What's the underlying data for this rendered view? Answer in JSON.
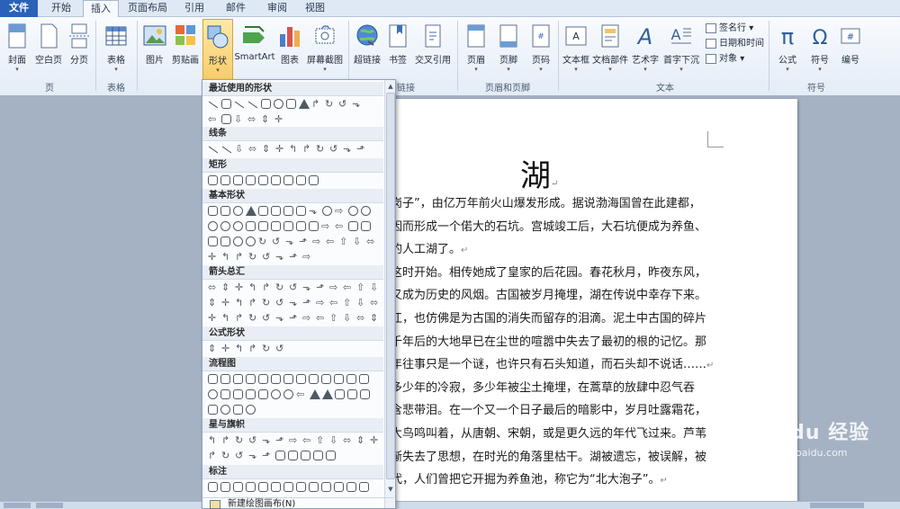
{
  "menubar": {
    "tabs": [
      {
        "label": "文件"
      },
      {
        "label": "开始"
      },
      {
        "label": "插入"
      },
      {
        "label": "页面布局"
      },
      {
        "label": "引用"
      },
      {
        "label": "邮件"
      },
      {
        "label": "审阅"
      },
      {
        "label": "视图"
      }
    ]
  },
  "ribbon": {
    "pages": {
      "cover": "封面",
      "blank": "空白页",
      "break": "分页",
      "group": "页"
    },
    "tables": {
      "table": "表格",
      "group": "表格"
    },
    "illustrations": {
      "picture": "图片",
      "clipart": "剪贴画",
      "shapes": "形状",
      "smartart": "SmartArt",
      "chart": "图表",
      "screenshot": "屏幕截图"
    },
    "links": {
      "hyperlink": "超链接",
      "bookmark": "书签",
      "crossref": "交叉引用",
      "group": "链接"
    },
    "headerfooter": {
      "header": "页眉",
      "footer": "页脚",
      "pagenum": "页码",
      "group": "页眉和页脚"
    },
    "text": {
      "textbox": "文本框",
      "parts": "文档部件",
      "wordart": "艺术字",
      "dropcap": "首字下沉",
      "signature": "签名行",
      "datetime": "日期和时间",
      "object": "对象",
      "group": "文本"
    },
    "symbols": {
      "equation": "公式",
      "symbol": "符号",
      "number": "编号",
      "group": "符号"
    }
  },
  "dropdown_arrow": "▾",
  "shapes_menu": {
    "sections": [
      {
        "title": "最近使用的形状"
      },
      {
        "title": "线条"
      },
      {
        "title": "矩形"
      },
      {
        "title": "基本形状"
      },
      {
        "title": "箭头总汇"
      },
      {
        "title": "公式形状"
      },
      {
        "title": "流程图"
      },
      {
        "title": "星与旗帜"
      },
      {
        "title": "标注"
      }
    ],
    "new_canvas": "新建绘图画布(N)"
  },
  "document": {
    "title": "湖",
    "lines": [
      "岗子”，由亿万年前火山爆发形成。据说渤海国曾在此建都，",
      "因而形成一个偌大的石坑。宫城竣工后，大石坑便成为养鱼、",
      "的人工湖了。",
      "这时开始。相传她成了皇家的后花园。春花秋月，昨夜东风，",
      "又成为历史的风烟。古国被岁月掩埋，湖在传说中幸存下来。",
      "江，也仿佛是为古国的消失而留存的泪滴。泥土中古国的碎片",
      "千年后的大地早已在尘世的喧嚣中失去了最初的根的记忆。那",
      "年往事只是一个谜，也许只有石头知道，而石头却不说话……",
      "多少年的冷寂，多少年被尘土掩埋，在蒿草的放肆中忍气吞",
      "含悲带泪。在一个又一个日子最后的暗影中，岁月吐露霜花，",
      "大鸟鸣叫着，从唐朝、宋朝，或是更久远的年代飞过来。芦苇",
      "渐失去了思想，在时光的角落里枯干。湖被遗忘，被误解，被",
      "代，人们曾把它开掘为养鱼池，称它为“北大泡子”。"
    ],
    "paragraph_mark": "↵"
  },
  "watermark": {
    "text": "Baidu 经验",
    "url": "jingyan.baidu.com"
  }
}
